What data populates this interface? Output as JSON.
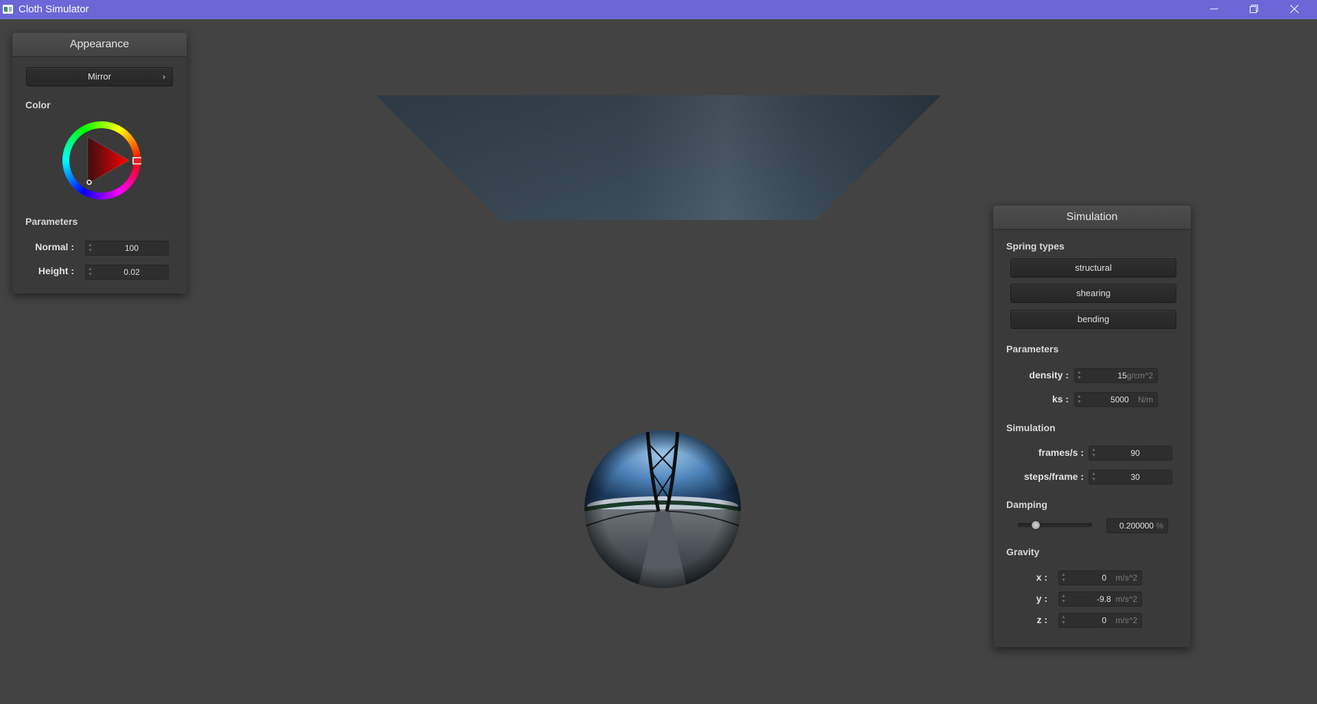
{
  "window": {
    "title": "Cloth Simulator",
    "icon": "app-window-icon",
    "controls": [
      "minimize-icon",
      "restore-icon",
      "close-icon"
    ],
    "titlebar_color": "#6b67d6"
  },
  "appearance": {
    "title": "Appearance",
    "shader_dropdown": "Mirror",
    "color_label": "Color",
    "parameters_label": "Parameters",
    "normal_label": "Normal :",
    "normal_value": "100",
    "height_label": "Height :",
    "height_value": "0.02",
    "selected_hue": "#ff0000"
  },
  "simulation": {
    "title": "Simulation",
    "spring_types_label": "Spring types",
    "spring_buttons": [
      "structural",
      "shearing",
      "bending"
    ],
    "parameters_label": "Parameters",
    "density_label": "density :",
    "density_value": "15",
    "density_unit": "g/cm^2",
    "ks_label": "ks :",
    "ks_value": "5000",
    "ks_unit": "N/m",
    "sim_label": "Simulation",
    "fps_label": "frames/s :",
    "fps_value": "90",
    "steps_label": "steps/frame :",
    "steps_value": "30",
    "damping_label": "Damping",
    "damping_value": "0.200000",
    "damping_unit": "%",
    "damping_slider_fraction": 0.2,
    "gravity_label": "Gravity",
    "gx_label": "x :",
    "gx_value": "0",
    "gy_label": "y :",
    "gy_value": "-9.8",
    "gz_label": "z :",
    "gz_value": "0",
    "gravity_unit": "m/s^2"
  }
}
